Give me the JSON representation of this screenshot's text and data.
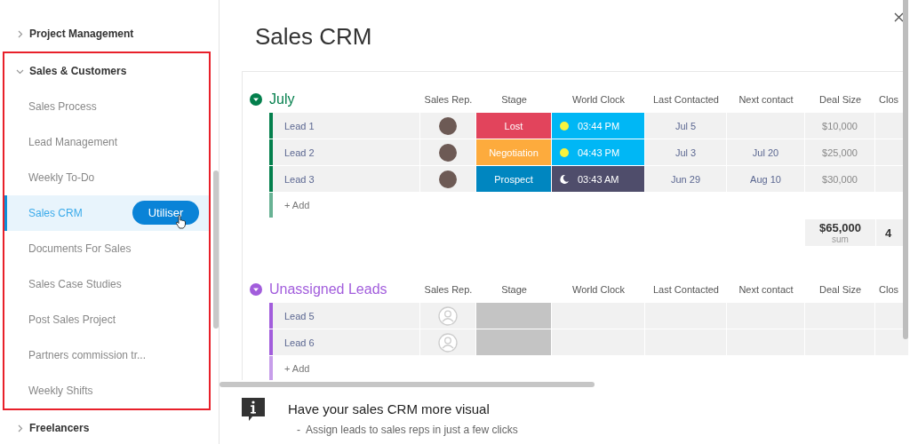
{
  "sidebar": {
    "categories": [
      {
        "label": "Project Management",
        "expanded": false,
        "highlighted": false
      },
      {
        "label": "Sales & Customers",
        "expanded": true,
        "highlighted": true,
        "children": [
          {
            "label": "Sales Process",
            "selected": false
          },
          {
            "label": "Lead Management",
            "selected": false
          },
          {
            "label": "Weekly To-Do",
            "selected": false
          },
          {
            "label": "Sales CRM",
            "selected": true,
            "button": "Utiliser"
          },
          {
            "label": "Documents For Sales",
            "selected": false
          },
          {
            "label": "Sales Case Studies",
            "selected": false
          },
          {
            "label": "Post Sales Project",
            "selected": false
          },
          {
            "label": "Partners commission tr...",
            "selected": false
          },
          {
            "label": "Weekly Shifts",
            "selected": false
          }
        ]
      },
      {
        "label": "Freelancers",
        "expanded": false,
        "highlighted": false
      }
    ]
  },
  "board": {
    "title": "Sales CRM",
    "groups": [
      {
        "name": "July",
        "color": "#037f4c",
        "columns": [
          "Sales Rep.",
          "Stage",
          "World Clock",
          "Last Contacted",
          "Next contact",
          "Deal Size",
          "Clos"
        ],
        "rows": [
          {
            "name": "Lead 1",
            "sales_rep": {
              "kind": "photo"
            },
            "stage": {
              "label": "Lost",
              "color": "#e2445c"
            },
            "world_clock": {
              "time": "03:44 PM",
              "kind": "day"
            },
            "last_contacted": "Jul 5",
            "deal_size": "$10,000"
          },
          {
            "name": "Lead 2",
            "sales_rep": {
              "kind": "photo"
            },
            "stage": {
              "label": "Negotiation",
              "color": "#fdab3d"
            },
            "world_clock": {
              "time": "04:43 PM",
              "kind": "day"
            },
            "last_contacted": "Jul 3",
            "next_contact": "Jul 20",
            "deal_size": "$25,000"
          },
          {
            "name": "Lead 3",
            "sales_rep": {
              "kind": "photo"
            },
            "stage": {
              "label": "Prospect",
              "color": "#0086c0"
            },
            "world_clock": {
              "time": "03:43 AM",
              "kind": "night"
            },
            "last_contacted": "Jun 29",
            "next_contact": "Aug 10",
            "deal_size": "$30,000"
          }
        ],
        "add_label": "+ Add",
        "summary": {
          "deal_size": "$65,000",
          "caption": "sum",
          "close": "4"
        }
      },
      {
        "name": "Unassigned Leads",
        "color": "#a25ddc",
        "columns": [
          "Sales Rep.",
          "Stage",
          "World Clock",
          "Last Contacted",
          "Next contact",
          "Deal Size",
          "Clos"
        ],
        "rows": [
          {
            "name": "Lead 5",
            "sales_rep": {
              "kind": "empty"
            },
            "stage": {
              "color": "#c4c4c4"
            }
          },
          {
            "name": "Lead 6",
            "sales_rep": {
              "kind": "empty"
            },
            "stage": {
              "color": "#c4c4c4"
            }
          }
        ],
        "add_label": "+ Add"
      }
    ]
  },
  "info": {
    "title": "Have your sales CRM more visual",
    "bullets": [
      "-  Assign leads to sales reps in just a few clicks"
    ]
  }
}
